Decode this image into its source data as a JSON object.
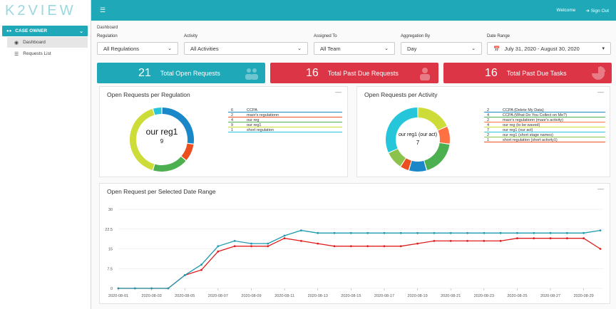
{
  "app": {
    "logo": "K2VIEW",
    "menu_icon": "hamburger-icon",
    "welcome": "Welcome",
    "signout": "Sign Out"
  },
  "sidebar": {
    "group_label": "CASE OWNER",
    "items": [
      {
        "label": "Dashboard",
        "icon": "dashboard-icon"
      },
      {
        "label": "Requests List",
        "icon": "list-icon"
      }
    ]
  },
  "breadcrumb": "Dashboard",
  "filters": {
    "regulation": {
      "label": "Regulation",
      "value": "All Regulations"
    },
    "activity": {
      "label": "Activity",
      "value": "All Activities"
    },
    "assigned": {
      "label": "Assigned To",
      "value": "All Team"
    },
    "aggregation": {
      "label": "Aggregation By",
      "value": "Day"
    },
    "daterange": {
      "label": "Date Range",
      "value": "July 31, 2020 - August 30, 2020"
    }
  },
  "kpis": [
    {
      "value": "21",
      "label": "Total Open Requests",
      "color": "#1fa8b8",
      "icon": "users-icon"
    },
    {
      "value": "16",
      "label": "Total Past Due Requests",
      "color": "#dc3545",
      "icon": "user-icon"
    },
    {
      "value": "16",
      "label": "Total Past Due Tasks",
      "color": "#dc3545",
      "icon": "pie-icon"
    }
  ],
  "chart_data": [
    {
      "type": "pie",
      "title": "Open Requests per Regulation",
      "center_label": "our reg1",
      "center_value": "9",
      "labels": [
        "CCPA",
        "maor's regulationn",
        "our reg",
        "our reg1",
        "short regulation"
      ],
      "values": [
        6,
        2,
        4,
        9,
        1
      ],
      "colors": [
        "#1a87c8",
        "#ec4e20",
        "#4caf50",
        "#cddc39",
        "#26c6da"
      ]
    },
    {
      "type": "pie",
      "title": "Open Requests per Activity",
      "center_label": "our reg1 (our act)",
      "center_value": "7",
      "labels": [
        "CCPA (Delete My Data)",
        "CCPA (What Do You Collect on Me?)",
        "maor's regulationn (maor's activity)",
        "our reg (to be waved)",
        "our reg1 (our act)",
        "our reg1 (short stage names)",
        "short regulation (short activity1)"
      ],
      "values": [
        2,
        4,
        2,
        4,
        7,
        2,
        1
      ],
      "colors": [
        "#1a87c8",
        "#4caf50",
        "#ff7043",
        "#cddc39",
        "#26c6da",
        "#8bc34a",
        "#ec4e20"
      ],
      "slice_order": [
        3,
        2,
        1,
        0,
        6,
        5,
        4
      ]
    },
    {
      "type": "line",
      "title": "Open Request per Selected Date Range",
      "x": [
        "2020-08-01",
        "2020-08-02",
        "2020-08-03",
        "2020-08-04",
        "2020-08-05",
        "2020-08-06",
        "2020-08-07",
        "2020-08-08",
        "2020-08-09",
        "2020-08-10",
        "2020-08-11",
        "2020-08-12",
        "2020-08-13",
        "2020-08-14",
        "2020-08-15",
        "2020-08-16",
        "2020-08-17",
        "2020-08-18",
        "2020-08-19",
        "2020-08-20",
        "2020-08-21",
        "2020-08-22",
        "2020-08-23",
        "2020-08-24",
        "2020-08-25",
        "2020-08-26",
        "2020-08-27",
        "2020-08-28",
        "2020-08-29",
        "2020-08-30"
      ],
      "xticks": [
        "2020-08-01",
        "2020-08-03",
        "2020-08-05",
        "2020-08-07",
        "2020-08-09",
        "2020-08-11",
        "2020-08-13",
        "2020-08-15",
        "2020-08-17",
        "2020-08-19",
        "2020-08-21",
        "2020-08-23",
        "2020-08-25",
        "2020-08-27",
        "2020-08-29"
      ],
      "ylim": [
        0,
        30
      ],
      "yticks": [
        "0",
        "7.5",
        "15",
        "22.5",
        "30"
      ],
      "series": [
        {
          "color": "#1f9bb0",
          "values": [
            0,
            0,
            0,
            0,
            5,
            9,
            16,
            18,
            17,
            17,
            20,
            22,
            21,
            21,
            21,
            21,
            21,
            21,
            21,
            21,
            21,
            21,
            21,
            21,
            21,
            21,
            21,
            21,
            21,
            22
          ]
        },
        {
          "color": "#e01e1e",
          "values": [
            0,
            0,
            0,
            0,
            5,
            7,
            14,
            16,
            16,
            16,
            19,
            18,
            17,
            16,
            16,
            16,
            16,
            16,
            17,
            18,
            18,
            18,
            18,
            18,
            19,
            19,
            19,
            19,
            19,
            15
          ]
        }
      ]
    }
  ]
}
